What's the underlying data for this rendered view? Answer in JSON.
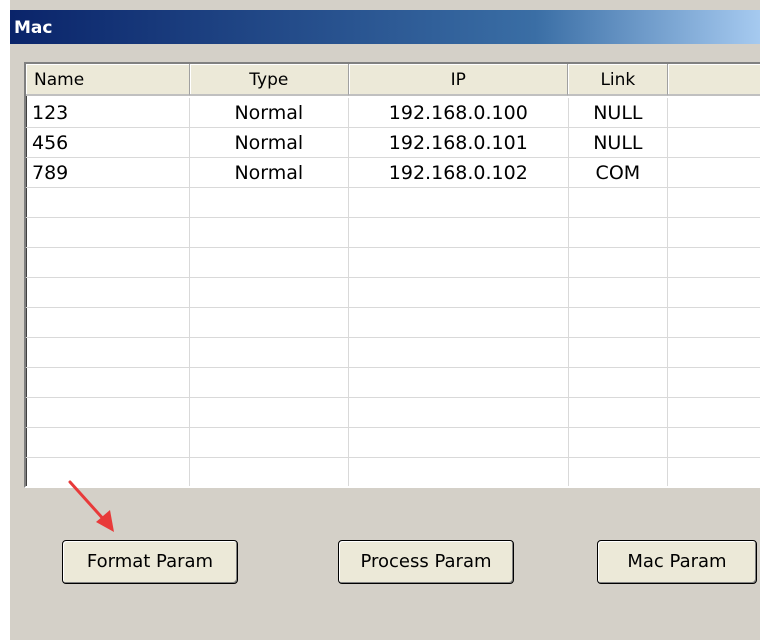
{
  "window": {
    "title": "Mac"
  },
  "list": {
    "columns": [
      "Name",
      "Type",
      "IP",
      "Link",
      ""
    ],
    "rows": [
      [
        "123",
        "Normal",
        "192.168.0.100",
        "NULL",
        ""
      ],
      [
        "456",
        "Normal",
        "192.168.0.101",
        "NULL",
        ""
      ],
      [
        "789",
        "Normal",
        "192.168.0.102",
        "COM",
        ""
      ]
    ],
    "empty_row_count": 10
  },
  "buttons": {
    "format": "Format Param",
    "process": "Process Param",
    "mac": "Mac Param"
  },
  "annotation": {
    "arrow_color": "#e83a3a",
    "arrow_icon": "red-arrow-icon"
  }
}
